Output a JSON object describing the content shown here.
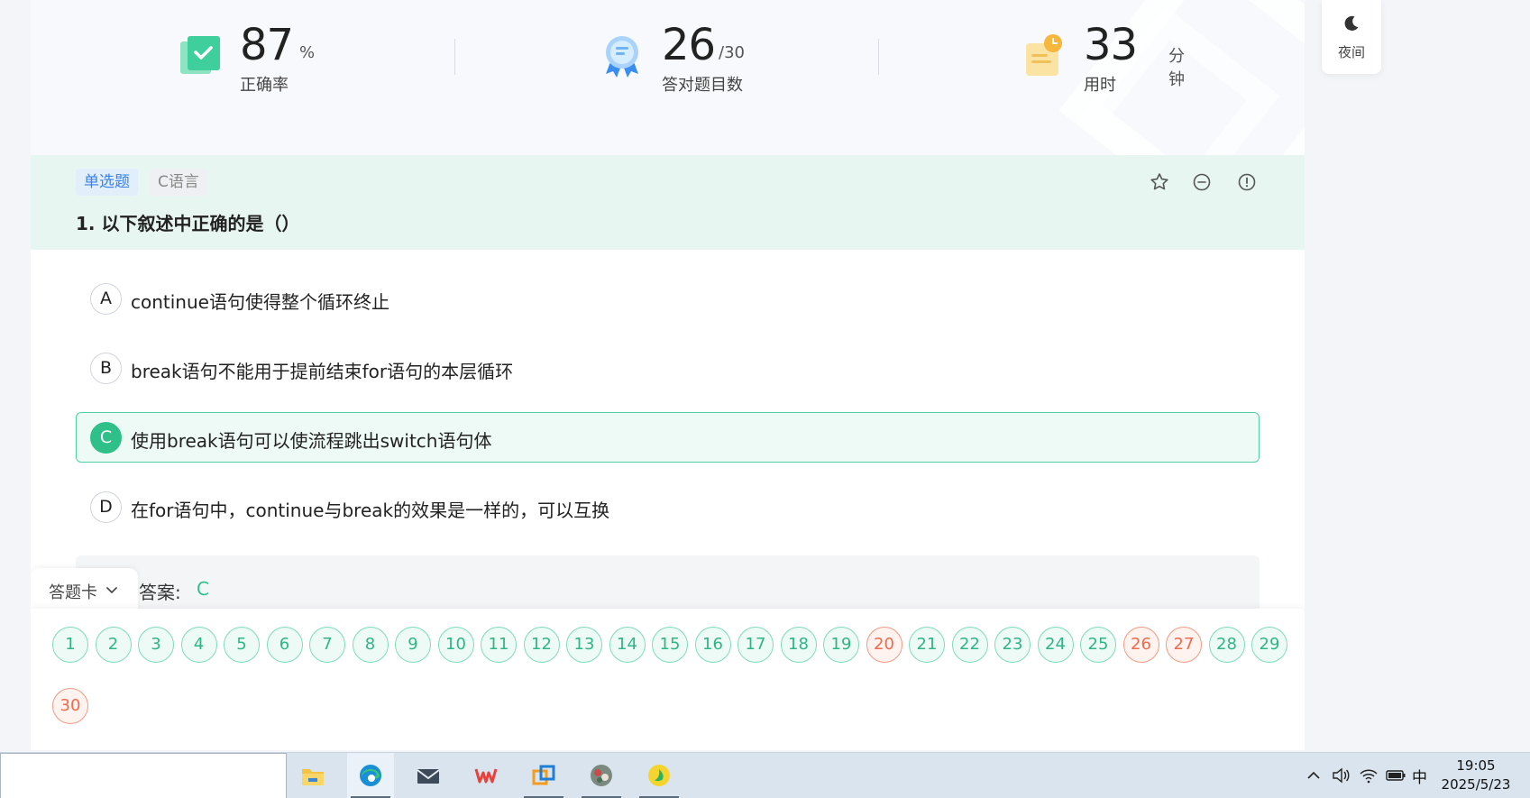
{
  "stats": [
    {
      "value": "87",
      "unit": "%",
      "label": "正确率"
    },
    {
      "value": "26",
      "unit": "/30",
      "label": "答对题目数"
    },
    {
      "value": "33",
      "unit": "分钟",
      "label": "用时"
    }
  ],
  "question": {
    "type_tag": "单选题",
    "lang_tag": "C语言",
    "title": "1. 以下叙述中正确的是（）",
    "options": [
      {
        "letter": "A",
        "text": "continue语句使得整个循环终止",
        "selected": false
      },
      {
        "letter": "B",
        "text": "break语句不能用于提前结束for语句的本层循环",
        "selected": false
      },
      {
        "letter": "C",
        "text": "使用break语句可以使流程跳出switch语句体",
        "selected": true
      },
      {
        "letter": "D",
        "text": "在for语句中，continue与break的效果是一样的，可以互换",
        "selected": false
      }
    ],
    "answer_label": "答案:",
    "answer_value": "C"
  },
  "answer_card": {
    "tab_label": "答题卡",
    "numbers": [
      {
        "n": "1",
        "status": "correct"
      },
      {
        "n": "2",
        "status": "correct"
      },
      {
        "n": "3",
        "status": "correct"
      },
      {
        "n": "4",
        "status": "correct"
      },
      {
        "n": "5",
        "status": "correct"
      },
      {
        "n": "6",
        "status": "correct"
      },
      {
        "n": "7",
        "status": "correct"
      },
      {
        "n": "8",
        "status": "correct"
      },
      {
        "n": "9",
        "status": "correct"
      },
      {
        "n": "10",
        "status": "correct"
      },
      {
        "n": "11",
        "status": "correct"
      },
      {
        "n": "12",
        "status": "correct"
      },
      {
        "n": "13",
        "status": "correct"
      },
      {
        "n": "14",
        "status": "correct"
      },
      {
        "n": "15",
        "status": "correct"
      },
      {
        "n": "16",
        "status": "correct"
      },
      {
        "n": "17",
        "status": "correct"
      },
      {
        "n": "18",
        "status": "correct"
      },
      {
        "n": "19",
        "status": "correct"
      },
      {
        "n": "20",
        "status": "wrong"
      },
      {
        "n": "21",
        "status": "correct"
      },
      {
        "n": "22",
        "status": "correct"
      },
      {
        "n": "23",
        "status": "correct"
      },
      {
        "n": "24",
        "status": "correct"
      },
      {
        "n": "25",
        "status": "correct"
      },
      {
        "n": "26",
        "status": "wrong"
      },
      {
        "n": "27",
        "status": "wrong"
      },
      {
        "n": "28",
        "status": "correct"
      },
      {
        "n": "29",
        "status": "correct"
      },
      {
        "n": "30",
        "status": "wrong"
      }
    ]
  },
  "night_mode": {
    "label": "夜间"
  },
  "taskbar": {
    "apps": [
      "file-explorer-icon",
      "edge-icon",
      "mail-icon",
      "wps-icon",
      "vmware-icon",
      "photo-app-icon",
      "music-app-icon"
    ],
    "ime": "中",
    "time": "19:05",
    "date": "2025/5/23"
  },
  "colors": {
    "accent": "#2fc08a",
    "wrong": "#ef6a4c",
    "tag_blue": "#3a82e6"
  }
}
